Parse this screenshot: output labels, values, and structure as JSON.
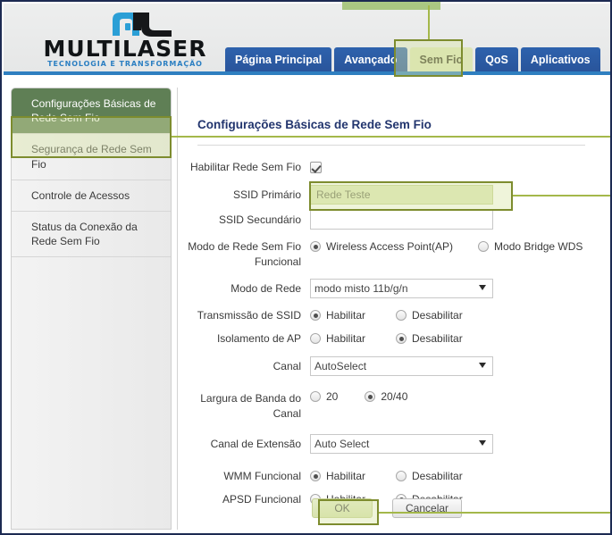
{
  "brand": {
    "wordmark": "MULTILASER",
    "tagline": "TECNOLOGIA E TRANSFORMAÇÃO",
    "logo_icon": "multilaser-ml-mark",
    "accent_blue": "#2b7fc2",
    "nav_blue": "#2e62ad",
    "highlight_olive": "#7d8c2e",
    "highlight_fill": "#dde5b6",
    "active_green": "#5f7f55",
    "title_navy": "#22356e"
  },
  "nav": {
    "tabs": [
      {
        "label": "Página Principal",
        "active": false
      },
      {
        "label": "Avançado",
        "active": false
      },
      {
        "label": "Sem Fio",
        "active": true
      },
      {
        "label": "QoS",
        "active": false
      },
      {
        "label": "Aplicativos",
        "active": false
      }
    ]
  },
  "sidebar": {
    "items": [
      {
        "label": "Configurações Básicas de Rede Sem Fio",
        "active": true
      },
      {
        "label": "Segurança de Rede Sem Fio",
        "active": false
      },
      {
        "label": "Controle de Acessos",
        "active": false
      },
      {
        "label": "Status da Conexão da Rede Sem Fio",
        "active": false
      }
    ]
  },
  "main": {
    "title": "Configurações Básicas de Rede Sem Fio",
    "fields": {
      "enable_wireless": {
        "label": "Habilitar Rede Sem Fio",
        "checked": true
      },
      "ssid_primary": {
        "label": "SSID Primário",
        "value": "Rede Teste",
        "placeholder": "",
        "highlighted": true
      },
      "ssid_secondary": {
        "label": "SSID Secundário",
        "value": "",
        "placeholder": ""
      },
      "wireless_mode": {
        "label": "Modo de Rede Sem Fio Funcional",
        "options": [
          "Wireless Access Point(AP)",
          "Modo Bridge WDS"
        ],
        "selected": "Wireless Access Point(AP)"
      },
      "network_mode": {
        "label": "Modo de Rede",
        "selected": "modo misto 11b/g/n"
      },
      "ssid_broadcast": {
        "label": "Transmissão de SSID",
        "options": [
          "Habilitar",
          "Desabilitar"
        ],
        "selected": "Habilitar"
      },
      "ap_isolation": {
        "label": "Isolamento de AP",
        "options": [
          "Habilitar",
          "Desabilitar"
        ],
        "selected": "Desabilitar"
      },
      "channel": {
        "label": "Canal",
        "selected": "AutoSelect"
      },
      "bandwidth": {
        "label": "Largura de Banda do Canal",
        "label_line1": "Largura de Banda do",
        "label_line2": "Canal",
        "options": [
          "20",
          "20/40"
        ],
        "selected": "20/40"
      },
      "extension_channel": {
        "label": "Canal de Extensão",
        "selected": "Auto Select"
      },
      "wmm": {
        "label": "WMM Funcional",
        "options": [
          "Habilitar",
          "Desabilitar"
        ],
        "selected": "Habilitar"
      },
      "apsd": {
        "label": "APSD Funcional",
        "options": [
          "Habilitar",
          "Desabilitar"
        ],
        "selected": "Desabilitar"
      }
    },
    "buttons": {
      "ok": "OK",
      "cancel": "Cancelar"
    }
  }
}
